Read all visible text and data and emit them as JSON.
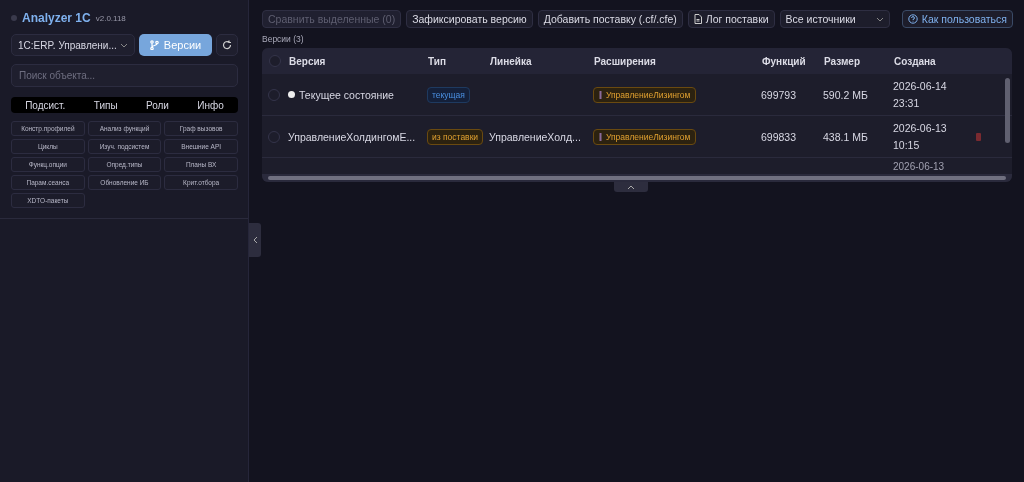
{
  "app": {
    "title": "Analyzer 1C",
    "version": "v2.0.118"
  },
  "sidebar": {
    "config_select": {
      "value": "1C:ERP. Управлени..."
    },
    "versions_button": "Версии",
    "search": {
      "placeholder": "Поиск объекта..."
    },
    "tabs": [
      {
        "label": "Подсист.",
        "selected": false
      },
      {
        "label": "Типы",
        "selected": false
      },
      {
        "label": "Роли",
        "selected": false
      },
      {
        "label": "Инфо",
        "selected": false
      }
    ],
    "tools": [
      "Констр.профилей",
      "Анализ функций",
      "Граф вызовов",
      "Циклы",
      "Изуч. подсистем",
      "Внешние API",
      "Функц.опции",
      "Опред.типы",
      "Планы ВХ",
      "Парам.сеанса",
      "Обновление ИБ",
      "Крит.отбора",
      "XDTO-пакеты"
    ]
  },
  "toolbar": {
    "compare": {
      "label": "Сравнить выделенные (0)",
      "disabled": true
    },
    "fix": {
      "label": "Зафиксировать версию",
      "disabled": false
    },
    "add": {
      "label": "Добавить поставку (.cf/.cfe)",
      "disabled": false
    },
    "log": "Лог поставки",
    "source_select": "Все источники",
    "help": "Как пользоваться"
  },
  "table": {
    "caption": "Версии (3)",
    "select_all_checked": false,
    "columns": [
      "Версия",
      "Тип",
      "Линейка",
      "Расширения",
      "Функций",
      "Размер",
      "Создана"
    ],
    "rows": [
      {
        "checked": false,
        "current": true,
        "version": "Текущее состояние",
        "type": {
          "label": "текущая",
          "kind": "current"
        },
        "line": "",
        "extension": "УправлениеЛизингом",
        "functions": "699793",
        "size": "590.2 МБ",
        "created": [
          "2026-06-14",
          "23:31"
        ],
        "deletable": false
      },
      {
        "checked": false,
        "current": false,
        "version": "УправлениеХолдингомЕ...",
        "type": {
          "label": "из поставки",
          "kind": "delivery"
        },
        "line": "УправлениеХолд...",
        "extension": "УправлениеЛизингом",
        "functions": "699833",
        "size": "438.1 МБ",
        "created": [
          "2026-06-13",
          "10:15"
        ],
        "deletable": true
      },
      {
        "created": [
          "2026-06-13"
        ]
      }
    ]
  }
}
